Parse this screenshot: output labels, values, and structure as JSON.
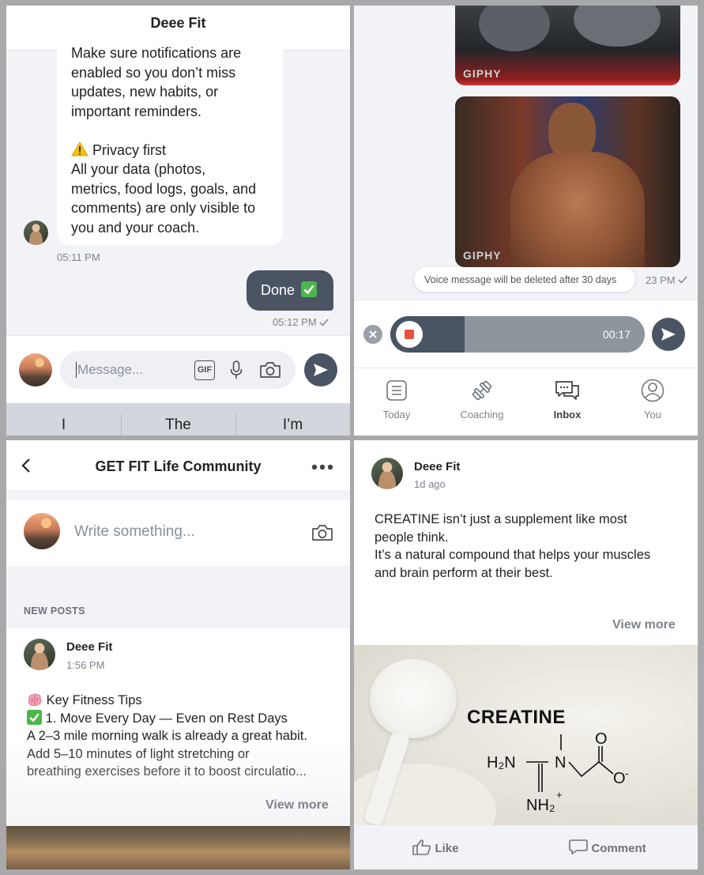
{
  "chat": {
    "title": "Deee Fit",
    "message_lines": [
      "Make sure notifications are",
      "enabled so you don’t miss",
      "updates, new habits, or",
      "important reminders."
    ],
    "privacy_heading": "Privacy first",
    "privacy_lines": [
      "All your data (photos,",
      "metrics, food logs, goals, and",
      "comments) are only visible to",
      "you and your coach."
    ],
    "message_time": "05:11 PM",
    "reply_text": "Done",
    "reply_time": "05:12 PM",
    "input_placeholder": "Message...",
    "gif_label": "GIF",
    "suggestions": [
      "I",
      "The",
      "I’m"
    ]
  },
  "voice": {
    "gif_watermark_1": "GIPHY",
    "gif_watermark_2": "GIPHY",
    "tooltip": "Voice message will be deleted after 30 days",
    "partial_time": "23 PM",
    "timer": "00:17",
    "recording_progress": 0.23,
    "nav": [
      {
        "label": "Today",
        "icon": "today-icon"
      },
      {
        "label": "Coaching",
        "icon": "dumbbell-icon"
      },
      {
        "label": "Inbox",
        "icon": "inbox-icon"
      },
      {
        "label": "You",
        "icon": "profile-icon"
      }
    ]
  },
  "community": {
    "title": "GET FIT Life Community",
    "write_placeholder": "Write something...",
    "section_label": "NEW POSTS",
    "post": {
      "author": "Deee Fit",
      "time": "1:56 PM",
      "lines": [
        "Key Fitness Tips",
        "1. Move Every Day — Even on Rest Days",
        "A 2–3 mile morning walk is already a great habit.",
        "Add 5–10 minutes of light stretching or",
        "breathing exercises before it to boost circulatio..."
      ],
      "view_more": "View more"
    }
  },
  "post_detail": {
    "author": "Deee Fit",
    "time": "1d ago",
    "lines": [
      "CREATINE isn’t just a supplement like most",
      "people think.",
      "It’s a natural compound that helps your muscles",
      "and brain perform at their best."
    ],
    "view_more": "View more",
    "image_title": "CREATINE",
    "formula": {
      "h2n": "H₂N",
      "n": "N",
      "nh2": "NH₂",
      "plus": "+",
      "o_top": "O",
      "o_minus": "O",
      "minus": "-"
    },
    "like_label": "Like",
    "comment_label": "Comment"
  },
  "colors": {
    "accent_dark": "#4a5463",
    "record_red": "#e8523a"
  }
}
